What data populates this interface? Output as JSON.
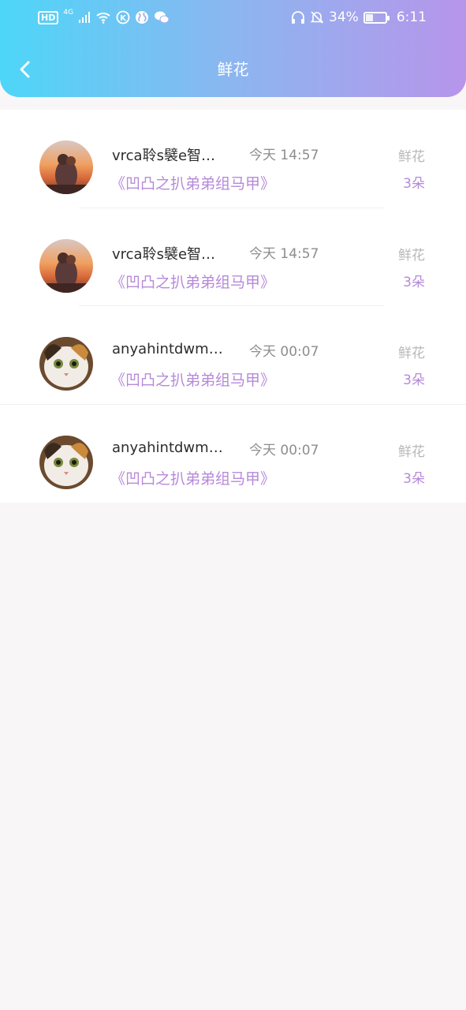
{
  "status_bar": {
    "network": "4G",
    "battery": "34%",
    "battery_level": 0.34,
    "time": "6:11"
  },
  "header": {
    "title": "鲜花",
    "back_icon": "chevron-left-icon"
  },
  "colors": {
    "gradient_start": "#4dd6f8",
    "gradient_end": "#b795ea",
    "accent": "#b689da"
  },
  "records": [
    {
      "avatar": "couple-sunset-photo",
      "name": "vrca聆s襞e智…",
      "time": "今天 14:57",
      "work": "《凹凸之扒弟弟组马甲》",
      "gift": "鲜花",
      "count": "3朵"
    },
    {
      "avatar": "couple-sunset-photo",
      "name": "vrca聆s襞e智…",
      "time": "今天 14:57",
      "work": "《凹凸之扒弟弟组马甲》",
      "gift": "鲜花",
      "count": "3朵"
    },
    {
      "avatar": "cat-photo",
      "name": "anyahintdwmu…",
      "time": "今天 00:07",
      "work": "《凹凸之扒弟弟组马甲》",
      "gift": "鲜花",
      "count": "3朵"
    },
    {
      "avatar": "cat-photo",
      "name": "anyahintdwmu…",
      "time": "今天 00:07",
      "work": "《凹凸之扒弟弟组马甲》",
      "gift": "鲜花",
      "count": "3朵"
    }
  ]
}
